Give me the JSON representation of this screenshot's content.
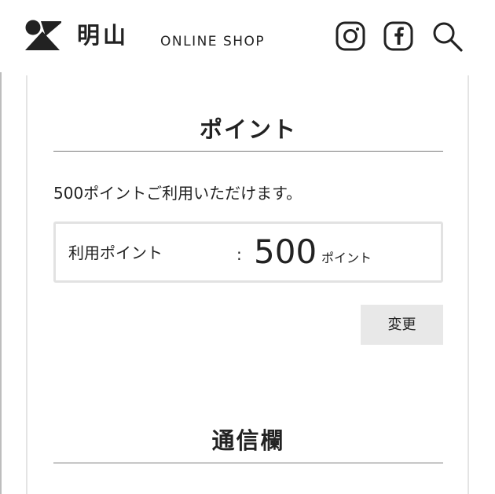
{
  "header": {
    "brand_name": "明山",
    "brand_sub": "ONLINE SHOP",
    "icons": [
      "logo-mark-icon",
      "instagram-icon",
      "facebook-icon",
      "search-icon"
    ]
  },
  "points_section": {
    "title": "ポイント",
    "notice": "500ポイントご利用いただけます。",
    "label": "利用ポイント",
    "colon": ":",
    "value": "500",
    "unit": "ポイント",
    "change_button": "変更"
  },
  "message_section": {
    "title": "通信欄"
  },
  "colors": {
    "text": "#222222",
    "rule": "#7a7a7a",
    "box_border": "#e2e2e2",
    "button_bg": "#e8e8e8"
  }
}
